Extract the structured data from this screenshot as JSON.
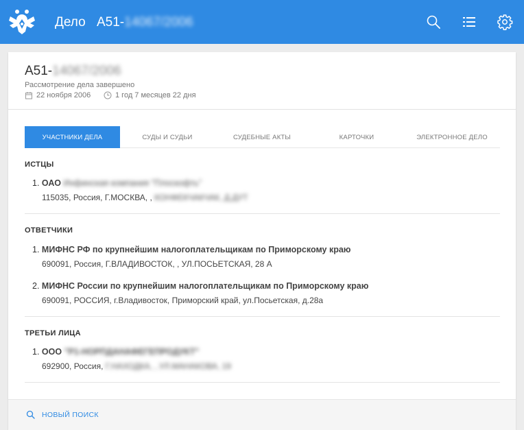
{
  "header": {
    "app_title": "Дело",
    "case_prefix": "А51-",
    "case_rest": "14067/2006",
    "logo_icon": "double-eagle-emblem",
    "icons": [
      "search-icon",
      "list-icon",
      "gear-icon"
    ],
    "bg_color": "#2f8ae3"
  },
  "case": {
    "number_prefix": "А51-",
    "number_rest": "14067/2006",
    "status": "Рассмотрение дела завершено",
    "date": "22 ноября 2006",
    "duration": "1 год 7 месяцев 22 дня"
  },
  "tabs": [
    "Участники дела",
    "Суды и судьи",
    "Судебные акты",
    "Карточки",
    "Электронное дело"
  ],
  "active_tab": "Участники дела",
  "sections": {
    "plaintiffs": {
      "title": "ИСТЦЫ",
      "items": [
        {
          "num": "1.",
          "name_prefix": "ОАО",
          "name_rest": "Инфинская компания \"Плоскофть\"",
          "addr_visible": "115035, Россия, Г.МОСКВА, ,",
          "addr_rest": "КОНФЕКЧАКЧАК, Д.ДУТ"
        }
      ]
    },
    "defendants": {
      "title": "ОТВЕТЧИКИ",
      "items": [
        {
          "num": "1.",
          "name": "МИФНС РФ по крупнейшим налогоплательщикам по Приморскому краю",
          "addr": "690091, Россия, Г.ВЛАДИВОСТОК, , УЛ.ПОСЬЕТСКАЯ, 28 А"
        },
        {
          "num": "2.",
          "name": "МИФНС России по крупнейшим налогоплательщикам по Приморскому краю",
          "addr": "690091, РОССИЯ, г.Владивосток, Приморский край, ул.Посьетская, д.28а"
        }
      ]
    },
    "third_parties": {
      "title": "ТРЕТЬИ ЛИЦА",
      "items": [
        {
          "num": "1.",
          "name_prefix": "ООО",
          "name_rest": "\"Р1-НОРПДАНАФЕГЕПРОДУКТ\"",
          "addr_visible": "692900, Россия,",
          "addr_rest": "Г.НАХОДКА, , УЛ.МАНАКОВА, 19"
        }
      ]
    }
  },
  "footer": {
    "new_search_label": "НОВЫЙ ПОИСК"
  }
}
